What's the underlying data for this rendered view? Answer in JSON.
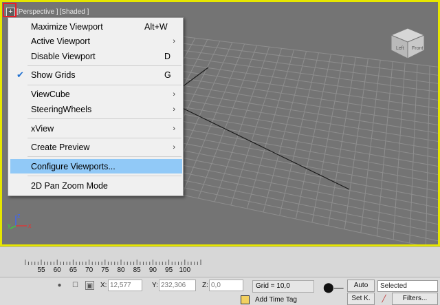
{
  "viewport": {
    "plus_label": "+",
    "view_label": "[Perspective ]",
    "shading_label": "[Shaded ]",
    "border_color": "#e6e600",
    "background_color": "#747474"
  },
  "annotation": {
    "color": "#e8202a",
    "icons": [
      "highlight-box",
      "arrow"
    ]
  },
  "context_menu": {
    "items": [
      {
        "label": "Maximize Viewport",
        "shortcut": "Alt+W",
        "submenu": false,
        "checked": false,
        "highlighted": false
      },
      {
        "label": "Active Viewport",
        "shortcut": "",
        "submenu": true,
        "checked": false,
        "highlighted": false
      },
      {
        "label": "Disable Viewport",
        "shortcut": "D",
        "submenu": false,
        "checked": false,
        "highlighted": false
      },
      {
        "label": "Show Grids",
        "shortcut": "G",
        "submenu": false,
        "checked": true,
        "highlighted": false
      },
      {
        "label": "ViewCube",
        "shortcut": "",
        "submenu": true,
        "checked": false,
        "highlighted": false
      },
      {
        "label": "SteeringWheels",
        "shortcut": "",
        "submenu": true,
        "checked": false,
        "highlighted": false
      },
      {
        "label": "xView",
        "shortcut": "",
        "submenu": true,
        "checked": false,
        "highlighted": false
      },
      {
        "label": "Create Preview",
        "shortcut": "",
        "submenu": true,
        "checked": false,
        "highlighted": false
      },
      {
        "label": "Configure Viewports...",
        "shortcut": "",
        "submenu": false,
        "checked": false,
        "highlighted": true
      },
      {
        "label": "2D Pan Zoom Mode",
        "shortcut": "",
        "submenu": false,
        "checked": false,
        "highlighted": false
      }
    ],
    "highlight_color": "#91c9f7"
  },
  "axis": {
    "z": "z",
    "y": "y",
    "x": "x"
  },
  "viewcube": {
    "top_label": "Top",
    "left_label": "Left",
    "front_label": "Front"
  },
  "timeline": {
    "ticks": [
      "55",
      "60",
      "65",
      "70",
      "75",
      "80",
      "85",
      "90",
      "95",
      "100"
    ]
  },
  "statusbar": {
    "x_label": "X:",
    "x_value": "12,577",
    "y_label": "Y:",
    "y_value": "232,306",
    "z_label": "Z:",
    "z_value": "0,0",
    "grid": "Grid = 10,0",
    "add_time_tag": "Add Time Tag",
    "auto_key": "Auto",
    "set_key": "Set K.",
    "selected": "Selected",
    "filters": "Filters..."
  }
}
